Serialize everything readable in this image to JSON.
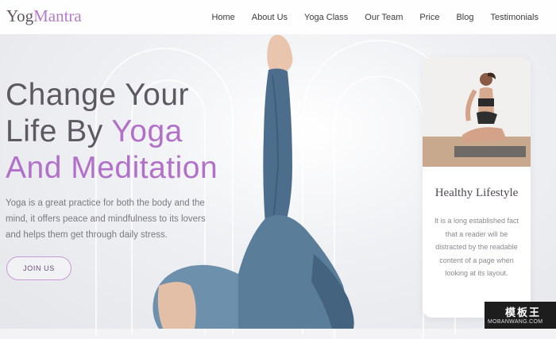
{
  "header": {
    "logo_part1": "Yog",
    "logo_part2": "Mantra",
    "nav": [
      "Home",
      "About Us",
      "Yoga Class",
      "Our Team",
      "Price",
      "Blog",
      "Testimonials"
    ]
  },
  "hero": {
    "title_line1": "Change Your",
    "title_line2_plain": "Life By ",
    "title_line2_highlight": "Yoga",
    "title_line3_highlight": "And Meditation",
    "description": "Yoga is a great practice for both the body and the mind, it offers peace and mindfulness to its lovers and helps them get through daily stress.",
    "cta_label": "JOIN US"
  },
  "card": {
    "title": "Healthy Lifestyle",
    "text": "It is a long established fact that a reader will be distracted by the readable content of a page when looking at its layout."
  },
  "watermark": {
    "main": "模板王",
    "sub": "MOBANWANG.COM"
  },
  "colors": {
    "accent": "#b271c9",
    "heading": "#5d5962",
    "leggings": "#4e6f8c"
  }
}
